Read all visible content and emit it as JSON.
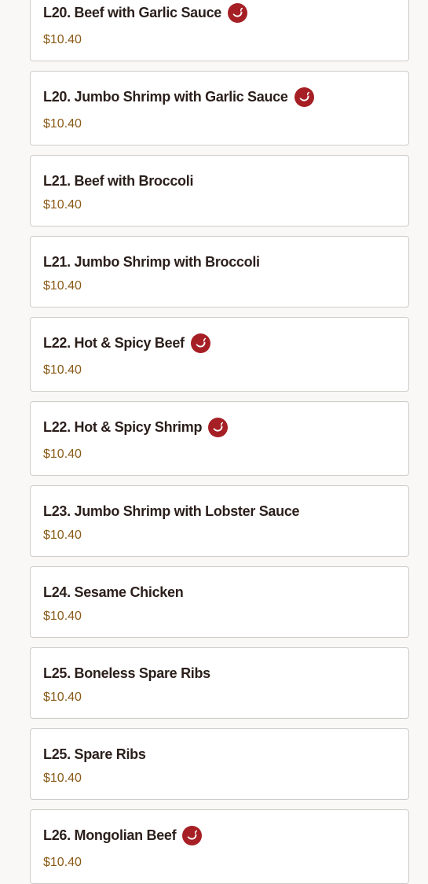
{
  "menu": {
    "items": [
      {
        "name": "L20. Beef with Garlic Sauce",
        "price": "$10.40",
        "spicy": true,
        "icon": "spicy-pepper-icon"
      },
      {
        "name": "L20. Jumbo Shrimp with Garlic Sauce",
        "price": "$10.40",
        "spicy": true,
        "icon": "spicy-pepper-icon"
      },
      {
        "name": "L21. Beef with Broccoli",
        "price": "$10.40",
        "spicy": false
      },
      {
        "name": "L21. Jumbo Shrimp with Broccoli",
        "price": "$10.40",
        "spicy": false
      },
      {
        "name": "L22. Hot & Spicy Beef",
        "price": "$10.40",
        "spicy": true,
        "icon": "spicy-pepper-icon"
      },
      {
        "name": "L22. Hot & Spicy Shrimp",
        "price": "$10.40",
        "spicy": true,
        "icon": "spicy-pepper-icon"
      },
      {
        "name": "L23. Jumbo Shrimp with Lobster Sauce",
        "price": "$10.40",
        "spicy": false
      },
      {
        "name": "L24. Sesame Chicken",
        "price": "$10.40",
        "spicy": false
      },
      {
        "name": "L25. Boneless Spare Ribs",
        "price": "$10.40",
        "spicy": false
      },
      {
        "name": "L25. Spare Ribs",
        "price": "$10.40",
        "spicy": false
      },
      {
        "name": "L26. Mongolian Beef",
        "price": "$10.40",
        "spicy": true,
        "icon": "spicy-pepper-icon"
      }
    ]
  },
  "colors": {
    "page_background": "#f9f8f6",
    "card_background": "#ffffff",
    "card_border": "#cfcdca",
    "item_name": "#2b1f1b",
    "price": "#8a5a18",
    "spicy_icon": "#a51f24"
  }
}
